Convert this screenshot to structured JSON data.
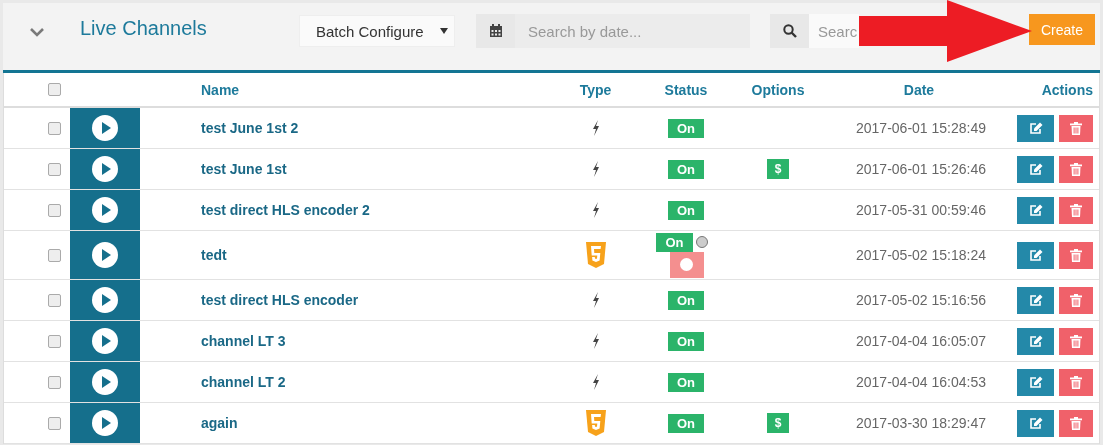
{
  "header": {
    "title": "Live Channels",
    "batch_select": "Batch Configure",
    "date_search": {
      "placeholder": "Search by date..."
    },
    "search": {
      "placeholder": "Searc"
    },
    "create_button": "Create"
  },
  "table": {
    "columns": [
      "Name",
      "Type",
      "Status",
      "Options",
      "Date",
      "Actions"
    ],
    "select_all": {
      "checked": false
    },
    "rows": [
      {
        "name": "test June 1st 2",
        "kind": "bolt",
        "status": "On",
        "recording": false,
        "option": null,
        "date": "2017-06-01 15:28:49",
        "checked": false
      },
      {
        "name": "test June 1st",
        "kind": "bolt",
        "status": "On",
        "recording": false,
        "option": "$",
        "date": "2017-06-01 15:26:46",
        "checked": false
      },
      {
        "name": "test direct HLS encoder 2",
        "kind": "bolt",
        "status": "On",
        "recording": false,
        "option": null,
        "date": "2017-05-31 00:59:46",
        "checked": false
      },
      {
        "name": "tedt",
        "kind": "html5",
        "status": "On",
        "recording": true,
        "option": null,
        "date": "2017-05-02 15:18:24",
        "checked": false
      },
      {
        "name": "test direct HLS encoder",
        "kind": "bolt",
        "status": "On",
        "recording": false,
        "option": null,
        "date": "2017-05-02 15:16:56",
        "checked": false
      },
      {
        "name": "channel LT 3",
        "kind": "bolt",
        "status": "On",
        "recording": false,
        "option": null,
        "date": "2017-04-04 16:05:07",
        "checked": false
      },
      {
        "name": "channel LT 2",
        "kind": "bolt",
        "status": "On",
        "recording": false,
        "option": null,
        "date": "2017-04-04 16:04:53",
        "checked": false
      },
      {
        "name": "again",
        "kind": "html5",
        "status": "On",
        "recording": false,
        "option": "$",
        "date": "2017-03-30 18:29:47",
        "checked": false
      }
    ]
  }
}
